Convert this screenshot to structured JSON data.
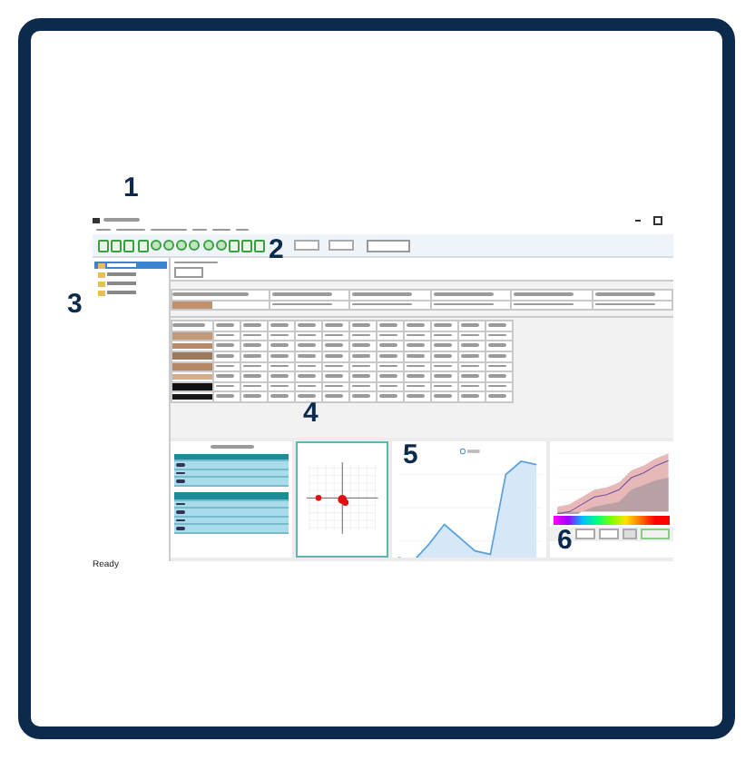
{
  "callouts": [
    "1",
    "2",
    "3",
    "4",
    "5",
    "6"
  ],
  "tree": [
    {
      "selected": true
    },
    {
      "selected": false
    },
    {
      "selected": false
    },
    {
      "selected": false
    }
  ],
  "standard_rows": [
    {
      "color": "#c0906e"
    }
  ],
  "sample_rows": [
    {
      "color": "#c49a78"
    },
    {
      "color": "#b88a68"
    },
    {
      "color": "#9c785c"
    },
    {
      "color": "#b58866"
    },
    {
      "color": "#d2ae8c"
    },
    {
      "color": "#111111"
    },
    {
      "color": "#181818"
    }
  ],
  "status_bar": {
    "text": "Ready"
  }
}
